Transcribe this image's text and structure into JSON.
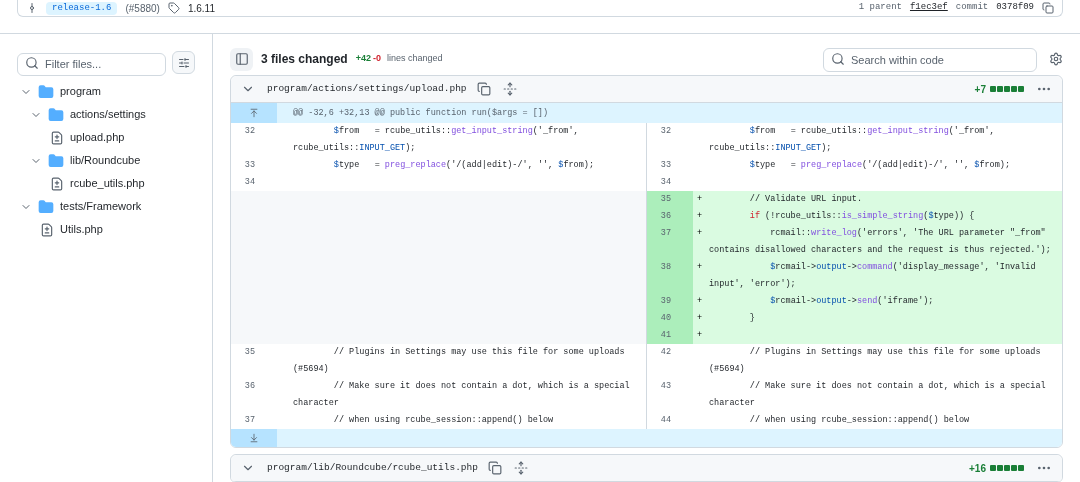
{
  "commit_bar": {
    "branch": "release-1.6",
    "pr": "(#5880)",
    "tag": "1.6.11",
    "parent_label": "1 parent",
    "parent_sha": "f1ec3ef",
    "commit_label": "commit",
    "commit_sha": "0378f09"
  },
  "sidebar": {
    "filter_placeholder": "Filter files...",
    "tree": [
      {
        "name": "program",
        "kind": "folder",
        "expanded": true,
        "children": [
          {
            "name": "actions/settings",
            "kind": "folder",
            "expanded": true,
            "children": [
              {
                "name": "upload.php",
                "kind": "file"
              }
            ]
          },
          {
            "name": "lib/Roundcube",
            "kind": "folder",
            "expanded": true,
            "children": [
              {
                "name": "rcube_utils.php",
                "kind": "file"
              }
            ]
          }
        ]
      },
      {
        "name": "tests/Framework",
        "kind": "folder",
        "expanded": true,
        "children": [
          {
            "name": "Utils.php",
            "kind": "file"
          }
        ]
      }
    ]
  },
  "summary": {
    "title": "3 files changed",
    "additions": "+42",
    "deletions": "-0",
    "note": "lines changed",
    "search_placeholder": "Search within code"
  },
  "files": [
    {
      "path": "program/actions/settings/upload.php",
      "expanded": true,
      "additions": "+7",
      "change_blocks": [
        {
          "kind": "added"
        },
        {
          "kind": "added"
        },
        {
          "kind": "added"
        },
        {
          "kind": "added"
        },
        {
          "kind": "added"
        }
      ],
      "hunk": "@@ -32,6 +32,13 @@ public function run($args = [])",
      "rows": [
        {
          "kind": "context",
          "left": {
            "num": "32",
            "segs": [
              {
                "text": "        $",
                "kind": "v"
              },
              {
                "text": "from   = rcube_utils::",
                "kind": "t"
              },
              {
                "text": "get_input_string",
                "kind": "f"
              },
              {
                "text": "('_from', rcube_utils::",
                "kind": "t"
              },
              {
                "text": "INPUT_GET",
                "kind": "c"
              },
              {
                "text": ");",
                "kind": "t"
              }
            ]
          },
          "right": {
            "num": "32",
            "segs": [
              {
                "text": "        $",
                "kind": "v"
              },
              {
                "text": "from   = rcube_utils::",
                "kind": "t"
              },
              {
                "text": "get_input_string",
                "kind": "f"
              },
              {
                "text": "('_from', rcube_utils::",
                "kind": "t"
              },
              {
                "text": "INPUT_GET",
                "kind": "c"
              },
              {
                "text": ");",
                "kind": "t"
              }
            ]
          }
        },
        {
          "kind": "context",
          "left": {
            "num": "33",
            "segs": [
              {
                "text": "        $",
                "kind": "v"
              },
              {
                "text": "type   = ",
                "kind": "t"
              },
              {
                "text": "preg_replace",
                "kind": "f"
              },
              {
                "text": "('/(add|edit)-/', '', ",
                "kind": "t"
              },
              {
                "text": "$",
                "kind": "v"
              },
              {
                "text": "from);",
                "kind": "t"
              }
            ]
          },
          "right": {
            "num": "33",
            "segs": [
              {
                "text": "        $",
                "kind": "v"
              },
              {
                "text": "type   = ",
                "kind": "t"
              },
              {
                "text": "preg_replace",
                "kind": "f"
              },
              {
                "text": "('/(add|edit)-/', '', ",
                "kind": "t"
              },
              {
                "text": "$",
                "kind": "v"
              },
              {
                "text": "from);",
                "kind": "t"
              }
            ]
          }
        },
        {
          "kind": "context",
          "left": {
            "num": "34"
          },
          "right": {
            "num": "34"
          }
        },
        {
          "kind": "added",
          "right": {
            "num": "35",
            "marker": "+",
            "segs": [
              {
                "text": "        // Validate URL input.",
                "kind": "t"
              }
            ]
          }
        },
        {
          "kind": "added",
          "right": {
            "num": "36",
            "marker": "+",
            "segs": [
              {
                "text": "        if",
                "kind": "k"
              },
              {
                "text": " (!rcube_utils::",
                "kind": "t"
              },
              {
                "text": "is_simple_string",
                "kind": "f"
              },
              {
                "text": "(",
                "kind": "t"
              },
              {
                "text": "$",
                "kind": "v"
              },
              {
                "text": "type)) {",
                "kind": "t"
              }
            ]
          }
        },
        {
          "kind": "added",
          "right": {
            "num": "37",
            "marker": "+",
            "segs": [
              {
                "text": "            rcmail::",
                "kind": "t"
              },
              {
                "text": "write_log",
                "kind": "f"
              },
              {
                "text": "('errors', 'The URL parameter \"_from\" contains disallowed characters and the request is thus rejected.');",
                "kind": "t"
              }
            ]
          }
        },
        {
          "kind": "added",
          "right": {
            "num": "38",
            "marker": "+",
            "segs": [
              {
                "text": "            $",
                "kind": "v"
              },
              {
                "text": "rcmail->",
                "kind": "t"
              },
              {
                "text": "output",
                "kind": "c"
              },
              {
                "text": "->",
                "kind": "t"
              },
              {
                "text": "command",
                "kind": "f"
              },
              {
                "text": "('display_message', 'Invalid input', 'error');",
                "kind": "t"
              }
            ]
          }
        },
        {
          "kind": "added",
          "right": {
            "num": "39",
            "marker": "+",
            "segs": [
              {
                "text": "            $",
                "kind": "v"
              },
              {
                "text": "rcmail->",
                "kind": "t"
              },
              {
                "text": "output",
                "kind": "c"
              },
              {
                "text": "->",
                "kind": "t"
              },
              {
                "text": "send",
                "kind": "f"
              },
              {
                "text": "('iframe');",
                "kind": "t"
              }
            ]
          }
        },
        {
          "kind": "added",
          "right": {
            "num": "40",
            "marker": "+",
            "segs": [
              {
                "text": "        }",
                "kind": "t"
              }
            ]
          }
        },
        {
          "kind": "added",
          "right": {
            "num": "41",
            "marker": "+"
          }
        },
        {
          "kind": "context",
          "left": {
            "num": "35",
            "segs": [
              {
                "text": "        // Plugins in Settings may use this file for some uploads (#5694)",
                "kind": "t"
              }
            ]
          },
          "right": {
            "num": "42",
            "segs": [
              {
                "text": "        // Plugins in Settings may use this file for some uploads (#5694)",
                "kind": "t"
              }
            ]
          }
        },
        {
          "kind": "context",
          "left": {
            "num": "36",
            "segs": [
              {
                "text": "        // Make sure it does not contain a dot, which is a special character",
                "kind": "t"
              }
            ]
          },
          "right": {
            "num": "43",
            "segs": [
              {
                "text": "        // Make sure it does not contain a dot, which is a special character",
                "kind": "t"
              }
            ]
          }
        },
        {
          "kind": "context",
          "left": {
            "num": "37",
            "segs": [
              {
                "text": "        // when using rcube_session::append() below",
                "kind": "t"
              }
            ]
          },
          "right": {
            "num": "44",
            "segs": [
              {
                "text": "        // when using rcube_session::append() below",
                "kind": "t"
              }
            ]
          }
        }
      ]
    },
    {
      "path": "program/lib/Roundcube/rcube_utils.php",
      "expanded": true,
      "additions": "+16",
      "change_blocks": [
        {
          "kind": "added"
        },
        {
          "kind": "added"
        },
        {
          "kind": "added"
        },
        {
          "kind": "added"
        },
        {
          "kind": "added"
        }
      ]
    }
  ]
}
